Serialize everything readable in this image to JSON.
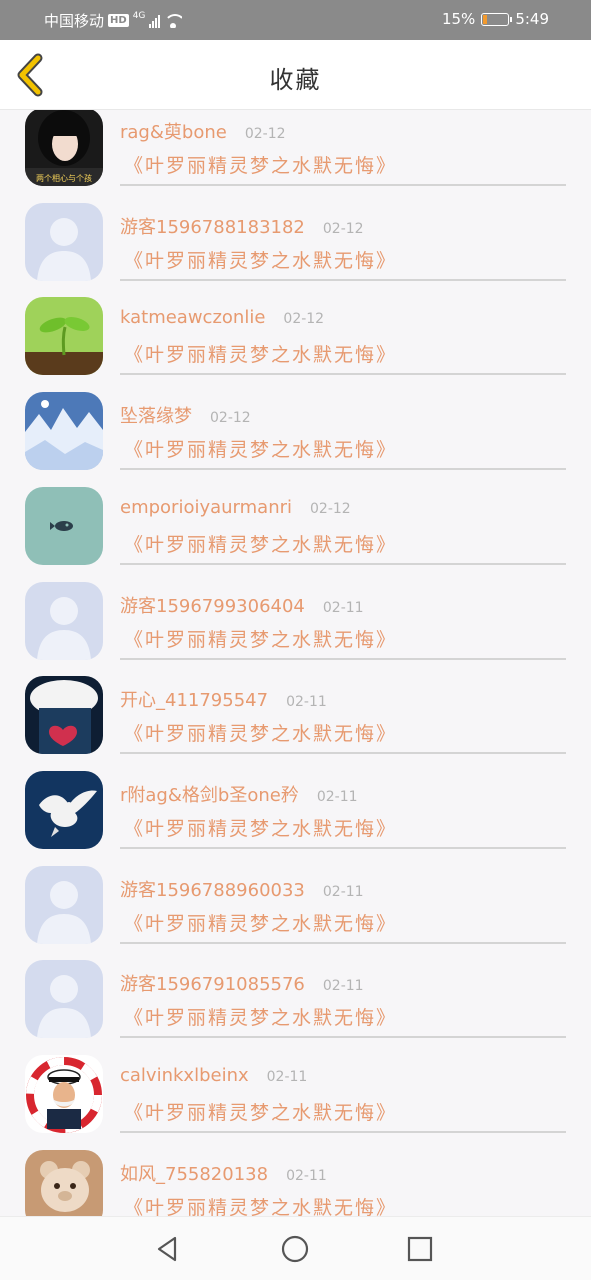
{
  "status_bar": {
    "carrier": "中国移动",
    "hd": "HD",
    "network": "4G",
    "battery_text": "15%",
    "battery_level": 0.15,
    "time": "5:49"
  },
  "header": {
    "title": "收藏",
    "back_icon": "chevron-left-icon"
  },
  "items": [
    {
      "name": "rag&萸bone",
      "date": "02-12",
      "book": "《叶罗丽精灵梦之水默无悔》",
      "avatar": "girl-photo",
      "avatar_caption": "两个相心与个孩"
    },
    {
      "name": "游客1596788183182",
      "date": "02-12",
      "book": "《叶罗丽精灵梦之水默无悔》",
      "avatar": "default-user",
      "avatar_caption": ""
    },
    {
      "name": "katmeawczonlie",
      "date": "02-12",
      "book": "《叶罗丽精灵梦之水默无悔》",
      "avatar": "sprout-photo",
      "avatar_caption": ""
    },
    {
      "name": "坠落缘梦",
      "date": "02-12",
      "book": "《叶罗丽精灵梦之水默无悔》",
      "avatar": "snow-photo",
      "avatar_caption": ""
    },
    {
      "name": "emporioiyaurmanri",
      "date": "02-12",
      "book": "《叶罗丽精灵梦之水默无悔》",
      "avatar": "teal-logo",
      "avatar_caption": ""
    },
    {
      "name": "游客1596799306404",
      "date": "02-11",
      "book": "《叶罗丽精灵梦之水默无悔》",
      "avatar": "default-user",
      "avatar_caption": ""
    },
    {
      "name": "开心_411795547",
      "date": "02-11",
      "book": "《叶罗丽精灵梦之水默无悔》",
      "avatar": "fur-photo",
      "avatar_caption": ""
    },
    {
      "name": "r附ag&格剑b圣one矜",
      "date": "02-11",
      "book": "《叶罗丽精灵梦之水默无悔》",
      "avatar": "dove-photo",
      "avatar_caption": ""
    },
    {
      "name": "游客1596788960033",
      "date": "02-11",
      "book": "《叶罗丽精灵梦之水默无悔》",
      "avatar": "default-user",
      "avatar_caption": ""
    },
    {
      "name": "游客1596791085576",
      "date": "02-11",
      "book": "《叶罗丽精灵梦之水默无悔》",
      "avatar": "default-user",
      "avatar_caption": ""
    },
    {
      "name": "calvinkxlbeinx",
      "date": "02-11",
      "book": "《叶罗丽精灵梦之水默无悔》",
      "avatar": "captain-photo",
      "avatar_caption": ""
    },
    {
      "name": "如风_755820138",
      "date": "02-11",
      "book": "《叶罗丽精灵梦之水默无悔》",
      "avatar": "teddy-photo",
      "avatar_caption": ""
    }
  ],
  "nav_bar": {
    "back_icon": "triangle-back-icon",
    "home_icon": "circle-home-icon",
    "recents_icon": "square-recents-icon"
  },
  "colors": {
    "accent": "#e79a70",
    "status_bar": "#8a8a8a",
    "divider": "#d4d4d4",
    "date": "#b4b4b4",
    "battery": "#f29a2e",
    "back_chevron": "#f2c200"
  }
}
